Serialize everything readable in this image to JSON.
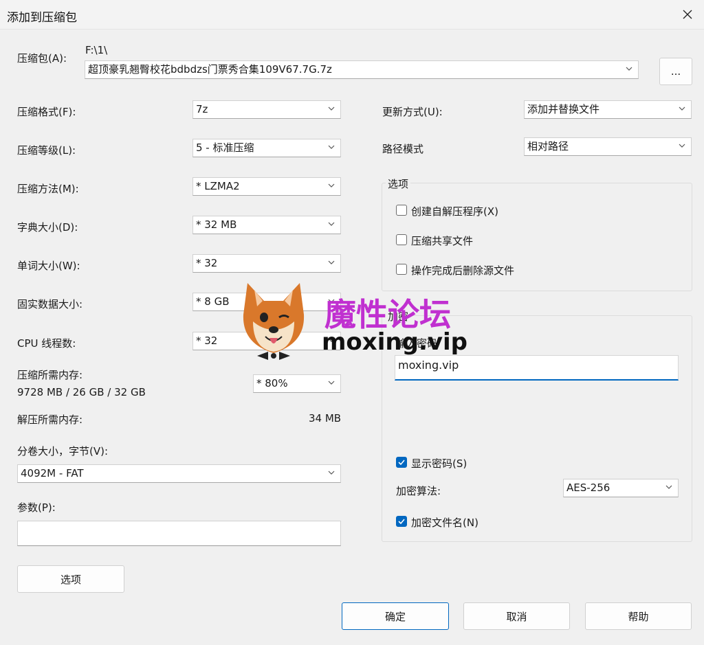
{
  "window": {
    "title": "添加到压缩包"
  },
  "archive": {
    "label": "压缩包(A):",
    "path": "F:\\1\\",
    "filename": "超顶豪乳翘臀校花bdbdzs门票秀合集109V67.7G.7z",
    "browse_label": "..."
  },
  "left": {
    "format": {
      "label": "压缩格式(F):",
      "value": "7z"
    },
    "level": {
      "label": "压缩等级(L):",
      "value": "5 - 标准压缩"
    },
    "method": {
      "label": "压缩方法(M):",
      "value": "*  LZMA2"
    },
    "dict": {
      "label": "字典大小(D):",
      "value": "*  32 MB"
    },
    "word": {
      "label": "单词大小(W):",
      "value": "*  32"
    },
    "solid": {
      "label": "固实数据大小:",
      "value": "*  8 GB"
    },
    "threads": {
      "label": "CPU 线程数:",
      "value": "*  32"
    },
    "mem": {
      "label": "压缩所需内存:",
      "detail": "9728 MB / 26 GB / 32 GB",
      "value": "*  80%"
    },
    "decomp": {
      "label": "解压所需内存:",
      "value": "34 MB"
    },
    "volume": {
      "label": "分卷大小，字节(V):",
      "value": "4092M - FAT"
    },
    "params": {
      "label": "参数(P):",
      "value": ""
    },
    "options_button": "选项"
  },
  "right": {
    "update": {
      "label": "更新方式(U):",
      "value": "添加并替换文件"
    },
    "pathmode": {
      "label": "路径模式",
      "value": "相对路径"
    },
    "options": {
      "title": "选项",
      "sfx": "创建自解压程序(X)",
      "shared": "压缩共享文件",
      "delete": "操作完成后删除源文件"
    },
    "encryption": {
      "title": "加密",
      "pw_label": "输入密码",
      "password": "moxing.vip",
      "show_pw": "显示密码(S)",
      "method_label": "加密算法:",
      "method": "AES-256",
      "encrypt_names": "加密文件名(N)"
    }
  },
  "buttons": {
    "ok": "确定",
    "cancel": "取消",
    "help": "帮助"
  },
  "watermark": {
    "text_cn": "魔性论坛",
    "text_en": "moxing.vip"
  },
  "colors": {
    "accent": "#0067c0",
    "watermark_cn": "#c030d0"
  }
}
